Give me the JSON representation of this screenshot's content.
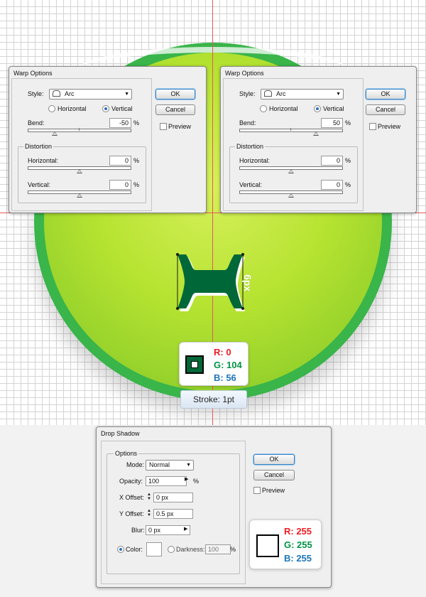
{
  "warp_left": {
    "title": "Warp Options",
    "style_label": "Style:",
    "style_value": "Arc",
    "horizontal_label": "Horizontal",
    "vertical_label": "Vertical",
    "bend_label": "Bend:",
    "bend_value": "-50",
    "percent": "%",
    "distortion_label": "Distortion",
    "dist_h_label": "Horizontal:",
    "dist_h_value": "0",
    "dist_v_label": "Vertical:",
    "dist_v_value": "0",
    "ok_label": "OK",
    "cancel_label": "Cancel",
    "preview_label": "Preview",
    "orientation_selected": "Vertical"
  },
  "warp_right": {
    "title": "Warp Options",
    "style_label": "Style:",
    "style_value": "Arc",
    "horizontal_label": "Horizontal",
    "vertical_label": "Vertical",
    "bend_label": "Bend:",
    "bend_value": "50",
    "percent": "%",
    "distortion_label": "Distortion",
    "dist_h_label": "Horizontal:",
    "dist_h_value": "0",
    "dist_v_label": "Vertical:",
    "dist_v_value": "0",
    "ok_label": "OK",
    "cancel_label": "Cancel",
    "preview_label": "Preview",
    "orientation_selected": "Vertical"
  },
  "artwork": {
    "dimension_label": "6px",
    "fill_color": "#006838",
    "circle_color": "#39b54a"
  },
  "stroke_swatch": {
    "r_label": "R: 0",
    "g_label": "G: 104",
    "b_label": "B: 56",
    "color": "#006838",
    "stroke_label": "Stroke: 1pt"
  },
  "drop_shadow": {
    "title": "Drop Shadow",
    "options_label": "Options",
    "mode_label": "Mode:",
    "mode_value": "Normal",
    "opacity_label": "Opacity:",
    "opacity_value": "100",
    "percent": "%",
    "x_offset_label": "X Offset:",
    "x_offset_value": "0 px",
    "y_offset_label": "Y Offset:",
    "y_offset_value": "0.5 px",
    "blur_label": "Blur:",
    "blur_value": "0 px",
    "color_label": "Color:",
    "darkness_label": "Darkness:",
    "darkness_value": "100",
    "ok_label": "OK",
    "cancel_label": "Cancel",
    "preview_label": "Preview",
    "shadow_color": "#ffffff"
  },
  "shadow_swatch": {
    "r_label": "R: 255",
    "g_label": "G: 255",
    "b_label": "B: 255"
  },
  "colors": {
    "red": "#ed1c24",
    "green": "#009444",
    "blue": "#1c75bc"
  }
}
